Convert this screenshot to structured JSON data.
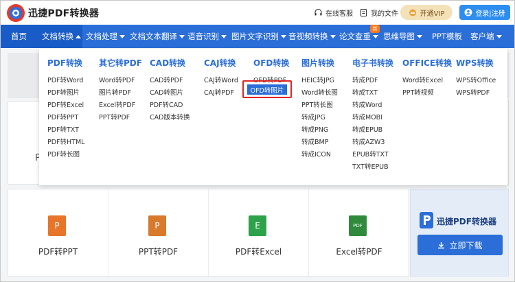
{
  "header": {
    "brand": "迅捷PDF转换器",
    "links": [
      "在线客服",
      "我的文件"
    ],
    "vip_label": "开通VIP",
    "login_label": "登录|注册"
  },
  "nav": {
    "home": "首页",
    "items": [
      "文档转换",
      "文档处理",
      "文档文本翻译",
      "语音识别",
      "图片文字识别",
      "音视频转换",
      "论文查重",
      "思维导图",
      "PPT模板",
      "客户端"
    ],
    "new_badge": "新"
  },
  "dropdown": {
    "columns": [
      {
        "title": "PDF转换",
        "items": [
          "PDF转Word",
          "PDF转图片",
          "PDF转Excel",
          "PDF转PPT",
          "PDF转TXT",
          "PDF转HTML",
          "PDF转长图"
        ]
      },
      {
        "title": "其它转PDF",
        "items": [
          "Word转PDF",
          "图片转PDF",
          "Excel转PDF",
          "PPT转PDF"
        ]
      },
      {
        "title": "CAD转换",
        "items": [
          "CAD转PDF",
          "CAD转图片",
          "PDF转CAD",
          "CAD版本转换"
        ]
      },
      {
        "title": "CAJ转换",
        "items": [
          "CAJ转Word",
          "CAJ转PDF"
        ]
      },
      {
        "title": "OFD转换",
        "items": [
          "OFD转PDF",
          "OFD转图片"
        ]
      },
      {
        "title": "图片转换",
        "items": [
          "HEIC转JPG",
          "Word转长图",
          "PPT转长图",
          "转成JPG",
          "转成PNG",
          "转成BMP",
          "转成ICON"
        ]
      },
      {
        "title": "电子书转换",
        "items": [
          "转成PDF",
          "转成TXT",
          "转成Word",
          "转成MOBI",
          "转成EPUB",
          "转成AZW3",
          "EPUB转TXT",
          "TXT转EPUB"
        ]
      },
      {
        "title": "OFFICE转换",
        "items": [
          "Word转Excel",
          "PPT转视频"
        ]
      },
      {
        "title": "WPS转换",
        "items": [
          "WPS转Office",
          "WPS转PDF"
        ]
      }
    ]
  },
  "tools": [
    {
      "label": "PDF转PPT",
      "icon": "P",
      "color": "#e8762a"
    },
    {
      "label": "PPT转PDF",
      "icon": "P",
      "color": "#d9792c"
    },
    {
      "label": "PDF转Excel",
      "icon": "E",
      "color": "#2ea24a"
    },
    {
      "label": "Excel转PDF",
      "icon": "PDF",
      "color": "#2f8a3c"
    }
  ],
  "promo": {
    "title": "迅捷PDF转换器",
    "download_label": "立即下载"
  },
  "side_letter": "P",
  "icons": {
    "headset": "headset-icon",
    "file": "file-icon",
    "crown": "crown-icon",
    "user": "user-icon",
    "download": "download-icon"
  }
}
